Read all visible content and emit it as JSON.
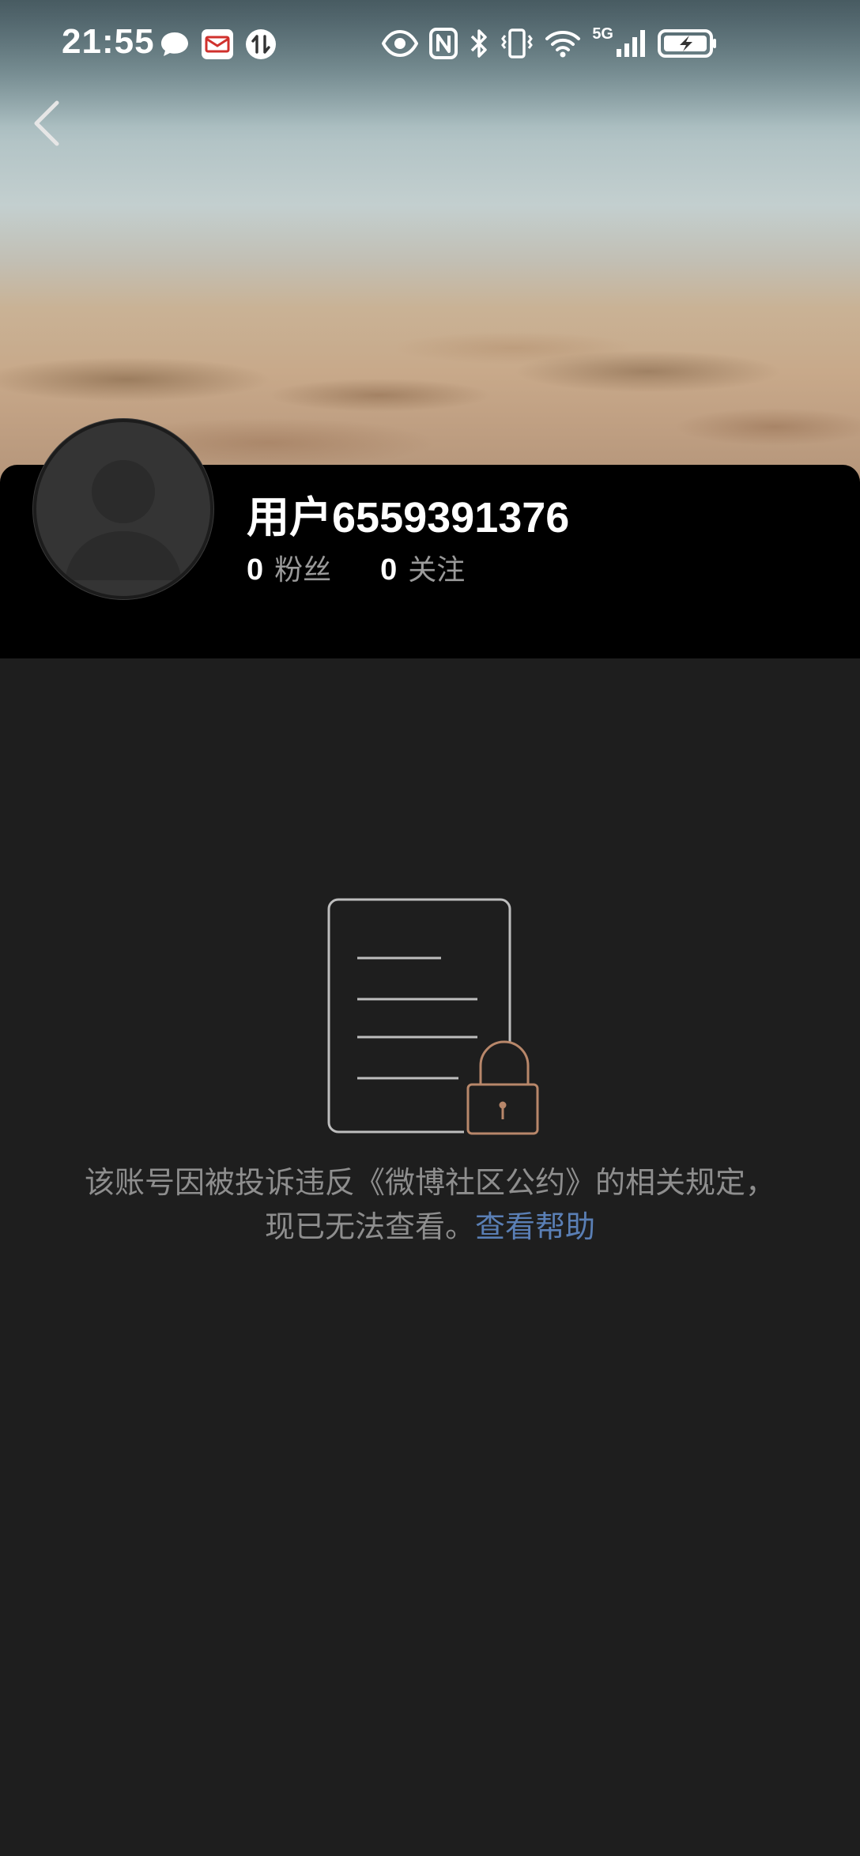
{
  "status_bar": {
    "time": "21:55",
    "network": "5G",
    "icons": [
      "message-icon",
      "mail-icon",
      "sync-icon",
      "eye-icon",
      "nfc-icon",
      "bluetooth-icon",
      "vibrate-icon",
      "wifi-icon",
      "signal-icon",
      "battery-charging-icon"
    ]
  },
  "nav": {
    "back_icon": "chevron-left-icon"
  },
  "profile": {
    "name": "用户6559391376",
    "followers_count": "0",
    "followers_label": "粉丝",
    "following_count": "0",
    "following_label": "关注"
  },
  "notice": {
    "message": "该账号因被投诉违反《微博社区公约》的相关规定，现已无法查看。",
    "help_link": "查看帮助",
    "illustration": "locked-document-icon"
  },
  "colors": {
    "background": "#1e1e1e",
    "header_panel": "#000000",
    "link": "#5a7fb5",
    "lock": "#b8876a",
    "muted_text": "#8e8e8e"
  }
}
